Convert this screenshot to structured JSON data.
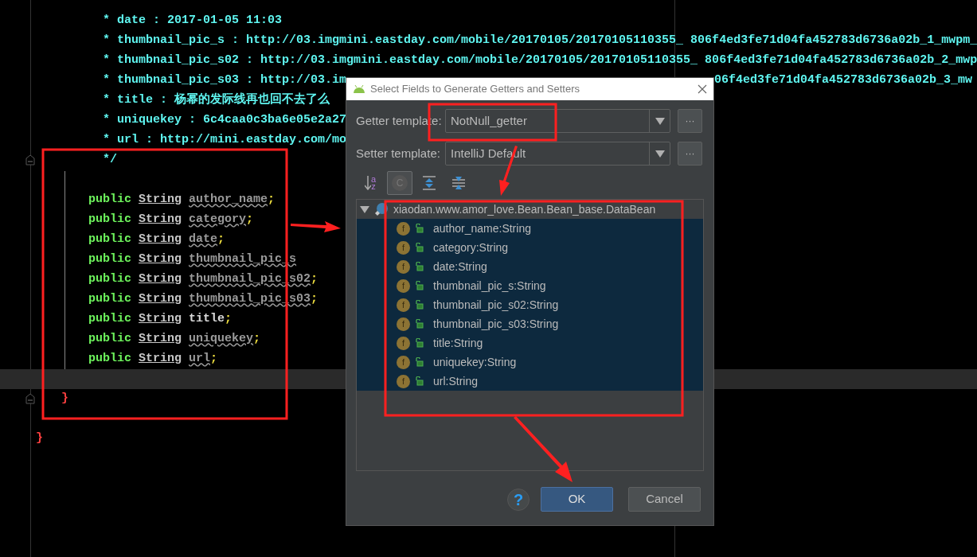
{
  "editor": {
    "lines": [
      {
        "kind": "comment",
        "text": "* date : 2017-01-05 11:03"
      },
      {
        "kind": "comment",
        "text": "* thumbnail_pic_s : http://03.imgmini.eastday.com/mobile/20170105/20170105110355_ 806f4ed3fe71d04fa452783d6736a02b_1_mwpm_"
      },
      {
        "kind": "comment",
        "text": "* thumbnail_pic_s02 : http://03.imgmini.eastday.com/mobile/20170105/20170105110355_ 806f4ed3fe71d04fa452783d6736a02b_2_mwp"
      },
      {
        "kind": "comment",
        "text": "* thumbnail_pic_s03 : http://03.im",
        "tail": "06f4ed3fe71d04fa452783d6736a02b_3_mw"
      },
      {
        "kind": "comment",
        "text": "* title : 杨幂的发际线再也回不去了么"
      },
      {
        "kind": "comment",
        "text": "* uniquekey : 6c4caa0c3ba6e05e2a27"
      },
      {
        "kind": "comment",
        "text": "* url : http://mini.eastday.com/mo"
      },
      {
        "kind": "comment_end",
        "text": "*/"
      },
      {
        "kind": "field",
        "modifier": "public",
        "type": "String",
        "name": "author_name",
        "end": ";",
        "warned": true
      },
      {
        "kind": "field",
        "modifier": "public",
        "type": "String",
        "name": "category",
        "end": ";",
        "warned": true
      },
      {
        "kind": "field",
        "modifier": "public",
        "type": "String",
        "name": "date",
        "end": ";",
        "warned": true
      },
      {
        "kind": "field",
        "modifier": "public",
        "type": "String",
        "name": "thumbnail_pic_s",
        "warned": true
      },
      {
        "kind": "field",
        "modifier": "public",
        "type": "String",
        "name": "thumbnail_pic_s02",
        "end": ";",
        "warned": true
      },
      {
        "kind": "field",
        "modifier": "public",
        "type": "String",
        "name": "thumbnail_pic_s03",
        "end": ";",
        "warned": true
      },
      {
        "kind": "field",
        "modifier": "public",
        "type": "String",
        "name": "title",
        "end": ";",
        "warned": false
      },
      {
        "kind": "field",
        "modifier": "public",
        "type": "String",
        "name": "uniquekey",
        "end": ";",
        "warned": true
      },
      {
        "kind": "field",
        "modifier": "public",
        "type": "String",
        "name": "url",
        "end": ";",
        "warned": true
      },
      {
        "kind": "class_end",
        "text": "}"
      },
      {
        "kind": "file_end",
        "text": "}"
      }
    ]
  },
  "dialog": {
    "title": "Select Fields to Generate Getters and Setters",
    "getter": {
      "label": "Getter template:",
      "value": "NotNull_getter",
      "more": "···"
    },
    "setter": {
      "label": "Setter template:",
      "value": "IntelliJ Default",
      "more": "···"
    },
    "toolbar": [
      {
        "kind": "sort",
        "top": "a",
        "bottom": "z",
        "selected": false
      },
      {
        "kind": "classes",
        "label": "C",
        "selected": true
      },
      {
        "kind": "expand",
        "selected": false
      },
      {
        "kind": "collapse",
        "selected": false
      }
    ],
    "tree": {
      "label": "xiaodan.www.amor_love.Bean.Bean_base.DataBean",
      "expanded": true,
      "children": [
        {
          "badge": "f",
          "label": "author_name:String",
          "selected": true
        },
        {
          "badge": "f",
          "label": "category:String",
          "selected": true
        },
        {
          "badge": "f",
          "label": "date:String",
          "selected": true
        },
        {
          "badge": "f",
          "label": "thumbnail_pic_s:String",
          "selected": true
        },
        {
          "badge": "f",
          "label": "thumbnail_pic_s02:String",
          "selected": true
        },
        {
          "badge": "f",
          "label": "thumbnail_pic_s03:String",
          "selected": true
        },
        {
          "badge": "f",
          "label": "title:String",
          "selected": true
        },
        {
          "badge": "f",
          "label": "uniquekey:String",
          "selected": true
        },
        {
          "badge": "f",
          "label": "url:String",
          "selected": true
        }
      ]
    },
    "help": "?",
    "ok": "OK",
    "cancel": "Cancel"
  }
}
